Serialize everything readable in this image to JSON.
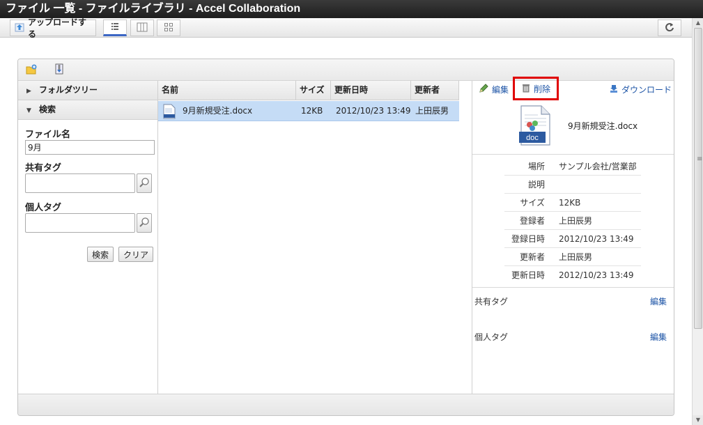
{
  "window": {
    "title": "ファイル 一覧 - ファイルライブラリ - Accel Collaboration"
  },
  "toolbar": {
    "upload_label": "アップロードする",
    "views": [
      "list-view-icon",
      "column-view-icon",
      "thumbnail-view-icon"
    ],
    "refresh_icon": "refresh-icon"
  },
  "panel_toolbar": {
    "icons": [
      "new-folder-icon",
      "download-zip-icon"
    ]
  },
  "sidebar": {
    "folder_tree_label": "フォルダツリー",
    "search_label": "検索",
    "file_name_label": "ファイル名",
    "file_name_value": "9月",
    "shared_tag_label": "共有タグ",
    "personal_tag_label": "個人タグ",
    "search_button": "検索",
    "clear_button": "クリア"
  },
  "grid": {
    "columns": [
      "名前",
      "サイズ",
      "更新日時",
      "更新者"
    ],
    "rows": [
      {
        "name": "9月新規受注.docx",
        "size": "12KB",
        "updated": "2012/10/23 13:49",
        "updater": "上田辰男"
      }
    ]
  },
  "detail": {
    "edit_label": "編集",
    "delete_label": "削除",
    "download_label": "ダウンロード",
    "file_name": "9月新規受注.docx",
    "file_badge": "doc",
    "properties": [
      {
        "key": "場所",
        "value": "サンプル会社/営業部"
      },
      {
        "key": "説明",
        "value": ""
      },
      {
        "key": "サイズ",
        "value": "12KB"
      },
      {
        "key": "登録者",
        "value": "上田辰男"
      },
      {
        "key": "登録日時",
        "value": "2012/10/23 13:49"
      },
      {
        "key": "更新者",
        "value": "上田辰男"
      },
      {
        "key": "更新日時",
        "value": "2012/10/23 13:49"
      }
    ],
    "shared_tag_label": "共有タグ",
    "shared_tag_edit": "編集",
    "personal_tag_label": "個人タグ",
    "personal_tag_edit": "編集"
  },
  "colors": {
    "accent": "#1d54a6",
    "selected_row": "#c5dcf6",
    "highlight": "#e00000"
  }
}
